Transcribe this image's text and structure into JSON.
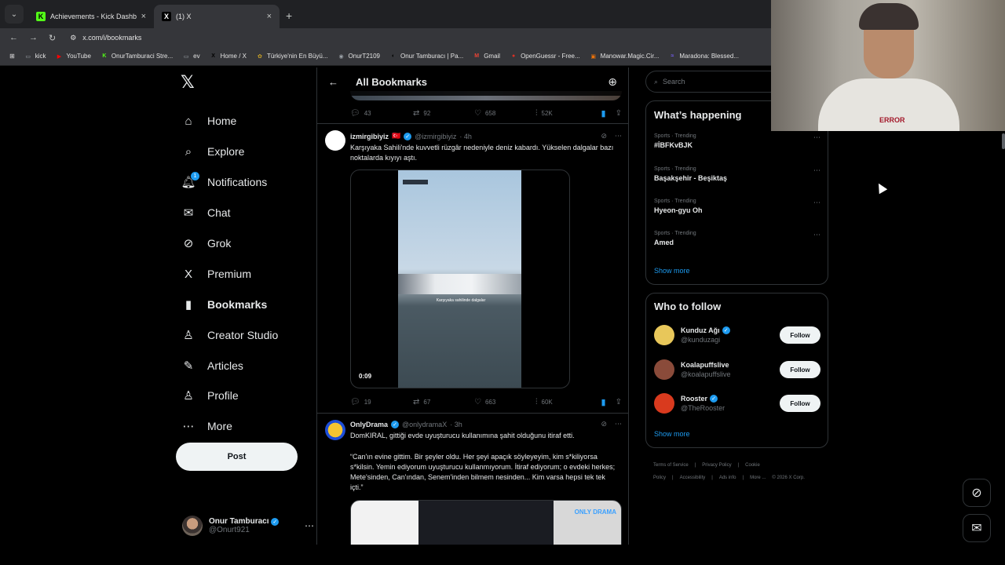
{
  "browser": {
    "tabs": [
      {
        "title": "Achievements - Kick Dashboard",
        "favicon": "kick-icon",
        "color": "#53fc18",
        "glyph": "K"
      },
      {
        "title": "(1) X",
        "favicon": "x-icon",
        "color": "#000000",
        "glyph": "X"
      }
    ],
    "url": "x.com/i/bookmarks",
    "bookmarks": [
      {
        "label": "kick",
        "glyph": "▭",
        "color": "#9aa0a6"
      },
      {
        "label": "YouTube",
        "glyph": "▶",
        "color": "#ff0000"
      },
      {
        "label": "OnurTamburaci Stre...",
        "glyph": "K",
        "color": "#53fc18"
      },
      {
        "label": "ev",
        "glyph": "▭",
        "color": "#9aa0a6"
      },
      {
        "label": "Home / X",
        "glyph": "X",
        "color": "#000000"
      },
      {
        "label": "Türkiye'nin En Büyü...",
        "glyph": "✿",
        "color": "#c9a227"
      },
      {
        "label": "OnurT2109",
        "glyph": "◉",
        "color": "#9aa0a6"
      },
      {
        "label": "Onur Tamburacı | Pa...",
        "glyph": "◐",
        "color": "#000000"
      },
      {
        "label": "Gmail",
        "glyph": "M",
        "color": "#ea4335"
      },
      {
        "label": "OpenGuessr - Free...",
        "glyph": "●",
        "color": "#d93025"
      },
      {
        "label": "Manowar.Magic.Cir...",
        "glyph": "▣",
        "color": "#e8710a"
      },
      {
        "label": "Maradona: Blessed...",
        "glyph": "≈",
        "color": "#7b61ff"
      }
    ]
  },
  "nav": {
    "items": [
      {
        "label": "Home",
        "icon": "home-icon",
        "glyph": "⌂"
      },
      {
        "label": "Explore",
        "icon": "search-icon",
        "glyph": "⌕"
      },
      {
        "label": "Notifications",
        "icon": "bell-icon",
        "glyph": "🔔︎",
        "badge": "1"
      },
      {
        "label": "Chat",
        "icon": "mail-icon",
        "glyph": "✉"
      },
      {
        "label": "Grok",
        "icon": "grok-icon",
        "glyph": "⊘"
      },
      {
        "label": "Premium",
        "icon": "x-icon",
        "glyph": "X"
      },
      {
        "label": "Bookmarks",
        "icon": "bookmark-icon",
        "glyph": "▮"
      },
      {
        "label": "Creator Studio",
        "icon": "creator-studio-icon",
        "glyph": "♙"
      },
      {
        "label": "Articles",
        "icon": "articles-icon",
        "glyph": "✎"
      },
      {
        "label": "Profile",
        "icon": "profile-icon",
        "glyph": "♙"
      },
      {
        "label": "More",
        "icon": "more-icon",
        "glyph": "⋯"
      }
    ],
    "post_label": "Post",
    "account": {
      "name": "Onur Tamburacı",
      "handle": "@Onurt921"
    }
  },
  "feed": {
    "title": "All Bookmarks",
    "prev_stats": {
      "replies": "43",
      "reposts": "92",
      "likes": "658",
      "views": "52K"
    },
    "tweets": [
      {
        "name": "izmirgibiyiz",
        "flag": "🇹🇷",
        "handle": "@izmirgibiyiz",
        "time": "· 4h",
        "text": "Karşıyaka Sahili'nde kuvvetli rüzgâr nedeniyle deniz kabardı. Yükselen dalgalar bazı noktalarda kıyıyı aştı.",
        "video_duration": "0:09",
        "video_caption": "Karşıyaka sahilinde dalgalar",
        "stats": {
          "replies": "19",
          "reposts": "67",
          "likes": "663",
          "views": "60K"
        }
      },
      {
        "name": "OnlyDrama",
        "handle": "@onlydramaX",
        "time": "· 3h",
        "text": "DomKIRAL, gittiği evde uyuşturucu kullanımına şahit olduğunu itiraf etti.",
        "quote": "“Can'ın evine gittim. Bir şeyler oldu. Her şeyi apaçık söyleyeyim, kim s*kiliyorsa s*kilsin. Yemin ediyorum uyuşturucu kullanmıyorum. İtiraf ediyorum; o evdeki herkes; Mete'sinden, Can'ından, Senem'inden bilmem nesinden... Kim varsa hepsi tek tek içti.”",
        "media_logo": "ONLY DRAMA"
      }
    ]
  },
  "right": {
    "search_placeholder": "Search",
    "happening_title": "What’s happening",
    "trends": [
      {
        "meta": "Sports · Trending",
        "name": "#İBFKvBJK"
      },
      {
        "meta": "Sports · Trending",
        "name": "Başakşehir - Beşiktaş"
      },
      {
        "meta": "Sports · Trending",
        "name": "Hyeon-gyu Oh"
      },
      {
        "meta": "Sports · Trending",
        "name": "Amed"
      }
    ],
    "show_more": "Show more",
    "who_title": "Who to follow",
    "follow": [
      {
        "name": "Kunduz Ağı",
        "handle": "@kunduzagi",
        "verified": true,
        "color": "#e8c75a"
      },
      {
        "name": "Koalapuffslive",
        "handle": "@koalapuffslive",
        "verified": false,
        "color": "#8a4b3a"
      },
      {
        "name": "Rooster",
        "handle": "@TheRooster",
        "verified": true,
        "color": "#d93a1e"
      }
    ],
    "follow_label": "Follow",
    "footer": [
      "Terms of Service",
      "|",
      "Privacy Policy",
      "|",
      "Cookie Policy",
      "|",
      "Accessibility",
      "|",
      "Ads info",
      "|",
      "More ...",
      "© 2026 X Corp."
    ]
  },
  "webcam": {
    "shirt_text": "ERROR"
  }
}
